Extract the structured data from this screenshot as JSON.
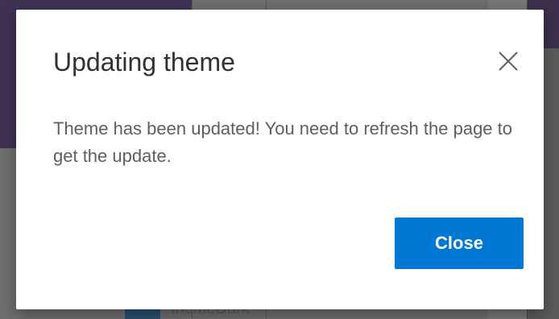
{
  "background": {
    "partial_text": "themeDark"
  },
  "dialog": {
    "title": "Updating theme",
    "close_icon": "close-icon",
    "message": "Theme has been updated! You need to refresh the page to get the update.",
    "close_button_label": "Close"
  },
  "colors": {
    "primary_button": "#0078d4",
    "title_text": "#323130",
    "body_text": "#605e5c"
  }
}
